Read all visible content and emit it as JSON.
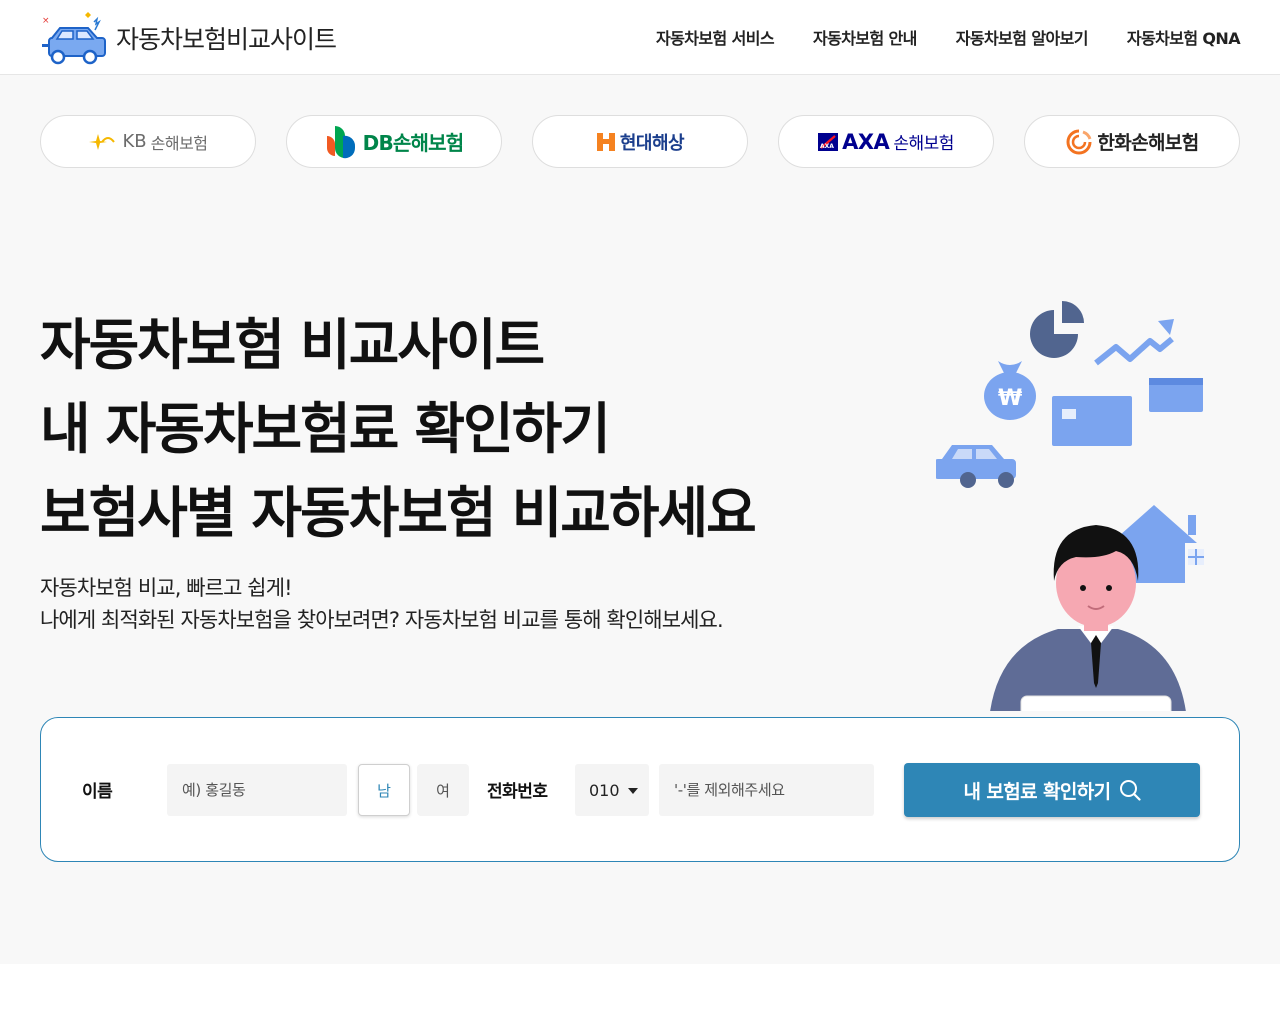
{
  "header": {
    "logo_text": "자동차보험비교사이트",
    "nav": [
      {
        "label": "자동차보험 서비스"
      },
      {
        "label": "자동차보험 안내"
      },
      {
        "label": "자동차보험 알아보기"
      },
      {
        "label": "자동차보험 QNA"
      }
    ]
  },
  "partners": [
    {
      "brand": "KB",
      "name": "손해보험",
      "icon": "kb-star-icon"
    },
    {
      "name": "DB손해보험",
      "icon": "db-logo-icon"
    },
    {
      "name": "현대해상",
      "icon": "hyundai-h-icon"
    },
    {
      "brand": "AXA",
      "name": "손해보험",
      "icon": "axa-logo-icon"
    },
    {
      "name": "한화손해보험",
      "icon": "hanwha-logo-icon"
    }
  ],
  "hero": {
    "headline": [
      "자동차보험 비교사이트",
      "내 자동차보험료 확인하기",
      "보험사별 자동차보험 비교하세요"
    ],
    "sub": [
      "자동차보험 비교, 빠르고 쉽게!",
      "나에게 최적화된 자동차보험을 찾아보려면? 자동차보험 비교를 통해 확인해보세요."
    ]
  },
  "form": {
    "name_label": "이름",
    "name_placeholder": "예) 홍길동",
    "gender_male": "남",
    "gender_female": "여",
    "phone_label": "전화번호",
    "phone_prefix": "010",
    "phone_placeholder": "'-'를 제외해주세요",
    "submit_label": "내 보험료 확인하기"
  },
  "colors": {
    "accent": "#2e86b6",
    "illustration_blue": "#7ba4ef",
    "hero_bg": "#f8f8f8"
  }
}
